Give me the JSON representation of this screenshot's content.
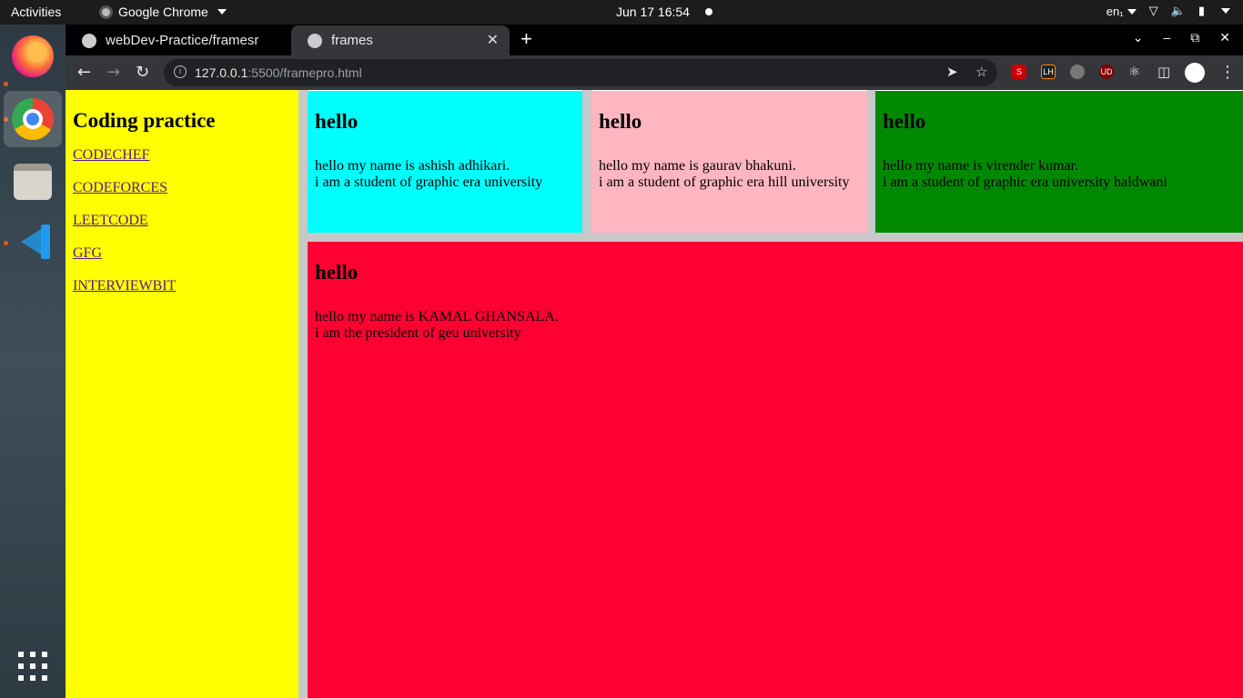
{
  "os": {
    "activities": "Activities",
    "app_menu": "Google Chrome",
    "clock": "Jun 17  16:54",
    "input_lang": "en₁"
  },
  "browser": {
    "tabs": [
      {
        "title": "webDev-Practice/framesr"
      },
      {
        "title": "frames"
      }
    ],
    "url_host": "127.0.0.1",
    "url_path": ":5500/framepro.html",
    "extensions": [
      "S",
      "LH",
      "UD"
    ]
  },
  "page": {
    "sidebar": {
      "heading": "Coding practice",
      "links": [
        "CODECHEF",
        "CODEFORCES",
        "LEETCODE",
        "GFG",
        "INTERVIEWBIT"
      ]
    },
    "frames": [
      {
        "heading": "hello",
        "line1": "hello my name is ashish adhikari.",
        "line2": "i am a student of graphic era university",
        "color": "#00ffff"
      },
      {
        "heading": "hello",
        "line1": "hello my name is gaurav bhakuni.",
        "line2": "i am a student of graphic era hill university",
        "color": "#ffb6c1"
      },
      {
        "heading": "hello",
        "line1": "hello my name is virender kumar.",
        "line2": "i am a student of graphic era university haldwani",
        "color": "#008800"
      },
      {
        "heading": "hello",
        "line1": "hello my name is KAMAL GHANSALA.",
        "line2": "i am the president of geu university",
        "color": "#ff0033"
      }
    ],
    "sidebar_color": "#ffff00"
  }
}
